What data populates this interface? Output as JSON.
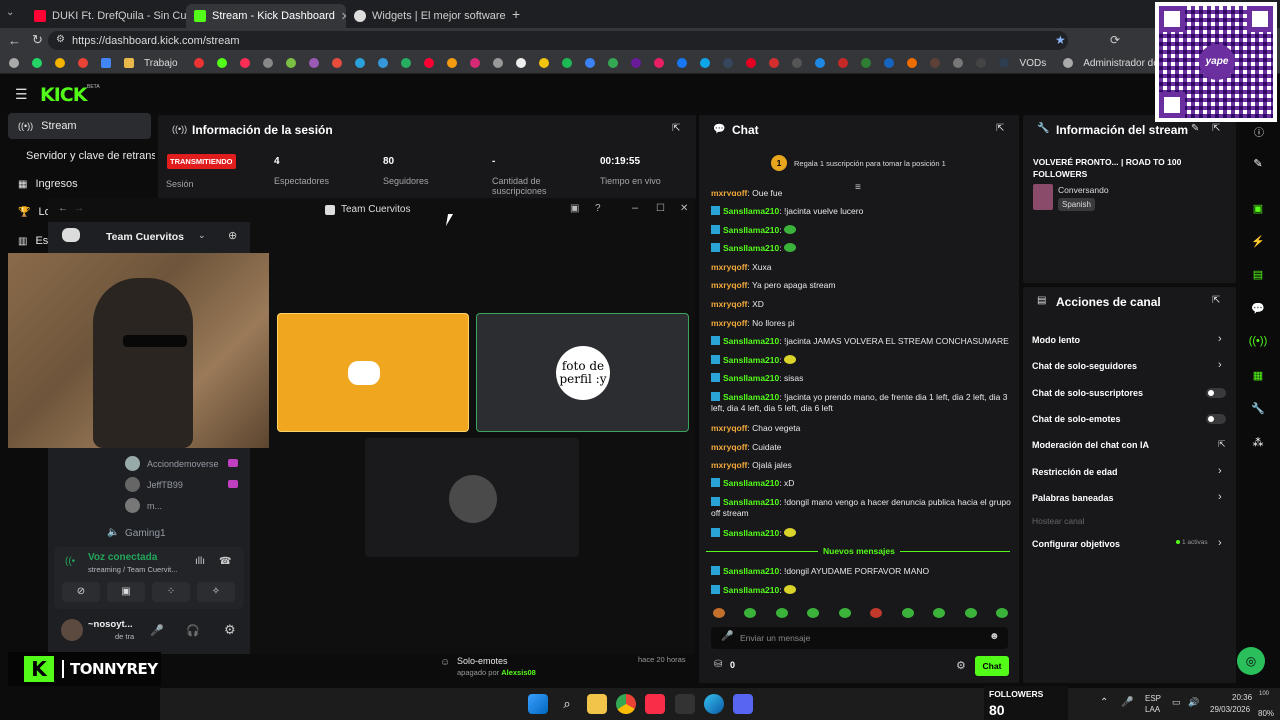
{
  "browser": {
    "tabs": [
      {
        "title": "DUKI Ft. DrefQuila - Sin Culpa (Vid",
        "favicon_color": "#ff0033"
      },
      {
        "title": "Stream - Kick Dashboard",
        "favicon_color": "#53fc18"
      },
      {
        "title": "Widgets | El mejor software para p",
        "favicon_color": "#ffffff"
      }
    ],
    "url": "https://dashboard.kick.com/stream",
    "bookmarks": {
      "trabajo": "Trabajo",
      "vods": "VODs",
      "admin": "Administrador de..."
    }
  },
  "kick": {
    "logo": "KICK",
    "logo_badge": "BETA",
    "nav": [
      {
        "label": "Stream"
      },
      {
        "label": "Servidor y clave de retransm"
      },
      {
        "label": "Ingresos"
      },
      {
        "label": "Lo"
      },
      {
        "label": "Est"
      }
    ]
  },
  "session": {
    "title": "Información de la sesión",
    "status": "TRANSMITIENDO",
    "status_label": "Sesión",
    "stats": [
      {
        "value": "4",
        "label": "Espectadores"
      },
      {
        "value": "80",
        "label": "Seguidores"
      },
      {
        "value": "-",
        "label": "Cantidad de suscripciones"
      },
      {
        "value": "00:19:55",
        "label": "Tiempo en vivo"
      }
    ]
  },
  "discord": {
    "window_title": "Team Cuervitos",
    "server_name": "Team Cuervitos",
    "members": [
      {
        "name": "Acciondemoverse"
      },
      {
        "name": "JeffTB99"
      },
      {
        "name": "m..."
      }
    ],
    "channel": "Gaming1",
    "voice_status": "Voz conectada",
    "voice_sub": "streaming / Team Cuervit...",
    "user_name": "~nosoyt...",
    "user_status": "de tra",
    "tile_text": "foto de perfil :y"
  },
  "streamer_name": "TONNYREY",
  "chat": {
    "title": "Chat",
    "sub_prompt": "Regala 1 suscripción para tomar la posición 1",
    "sub_rank": "1",
    "top_partial": {
      "user": "mxryqoff",
      "text": "Que fue"
    },
    "messages": [
      {
        "user": "Sansllama210",
        "text": "!jacinta vuelve lucero",
        "type": "a"
      },
      {
        "user": "Sansllama210",
        "text": "",
        "type": "a",
        "emote": "g"
      },
      {
        "user": "Sansllama210",
        "text": "",
        "type": "a",
        "emote": "g"
      },
      {
        "user": "mxryqoff",
        "text": "Xuxa",
        "type": "b"
      },
      {
        "user": "mxryqoff",
        "text": "Ya pero apaga stream",
        "type": "b"
      },
      {
        "user": "mxryqoff",
        "text": "XD",
        "type": "b"
      },
      {
        "user": "mxryqoff",
        "text": "No llores pi",
        "type": "b"
      },
      {
        "user": "Sansllama210",
        "text": "!jacinta JAMAS VOLVERA EL STREAM CONCHASUMARE",
        "type": "a"
      },
      {
        "user": "Sansllama210",
        "text": "",
        "type": "a",
        "emote": "y"
      },
      {
        "user": "Sansllama210",
        "text": "sisas",
        "type": "a"
      },
      {
        "user": "Sansllama210",
        "text": "!jacinta yo prendo mano, de frente dia 1 left, dia 2 left, dia 3 left, dia 4 left, dia 5 left, dia 6 left",
        "type": "a"
      },
      {
        "user": "mxryqoff",
        "text": "Chao vegeta",
        "type": "b"
      },
      {
        "user": "mxryqoff",
        "text": "Cuidate",
        "type": "b"
      },
      {
        "user": "mxryqoff",
        "text": "Ojalá jales",
        "type": "b"
      },
      {
        "user": "Sansllama210",
        "text": "xD",
        "type": "a"
      },
      {
        "user": "Sansllama210",
        "text": "!dongil mano vengo a hacer denuncia publica hacia el grupo off stream",
        "type": "a"
      },
      {
        "user": "Sansllama210",
        "text": "",
        "type": "a",
        "emote": "y"
      }
    ],
    "new_messages_label": "Nuevos mensajes",
    "new_messages": [
      {
        "user": "Sansllama210",
        "text": "!dongil AYUDAME PORFAVOR MANO",
        "type": "a"
      },
      {
        "user": "Sansllama210",
        "text": "",
        "type": "a",
        "emote": "y"
      }
    ],
    "input_placeholder": "Enviar un mensaje",
    "points": "0",
    "send_label": "Chat",
    "activity": {
      "title": "Solo-emotes",
      "time": "hace 20 horas",
      "by_prefix": "apagado por",
      "by_user": "Alexsis08"
    }
  },
  "stream_info": {
    "title": "Información del stream",
    "stream_title": "VOLVERÉ PRONTO... | ROAD TO 100 FOLLOWERS",
    "category": "Conversando",
    "language": "Spanish"
  },
  "channel_actions": {
    "title": "Acciones de canal",
    "items": [
      {
        "label": "Modo lento",
        "control": "chevron"
      },
      {
        "label": "Chat de solo-seguidores",
        "control": "chevron"
      },
      {
        "label": "Chat de solo-suscriptores",
        "control": "toggle"
      },
      {
        "label": "Chat de solo-emotes",
        "control": "toggle"
      },
      {
        "label": "Moderación del chat con IA",
        "control": "external"
      },
      {
        "label": "Restricción de edad",
        "control": "chevron"
      },
      {
        "label": "Palabras baneadas",
        "control": "chevron"
      }
    ],
    "disabled_item": "Hostear canal",
    "goals": {
      "label": "Configurar objetivos",
      "badge": "1 activas"
    }
  },
  "followers_widget": {
    "label": "FOLLOWERS",
    "value": "80"
  },
  "qr_text": "yape",
  "taskbar": {
    "lang": "ESP",
    "lang2": "LAA",
    "time": "20:36",
    "date": "29/03/2026"
  },
  "overlay_side": {
    "top": "100",
    "bottom": "80%"
  }
}
